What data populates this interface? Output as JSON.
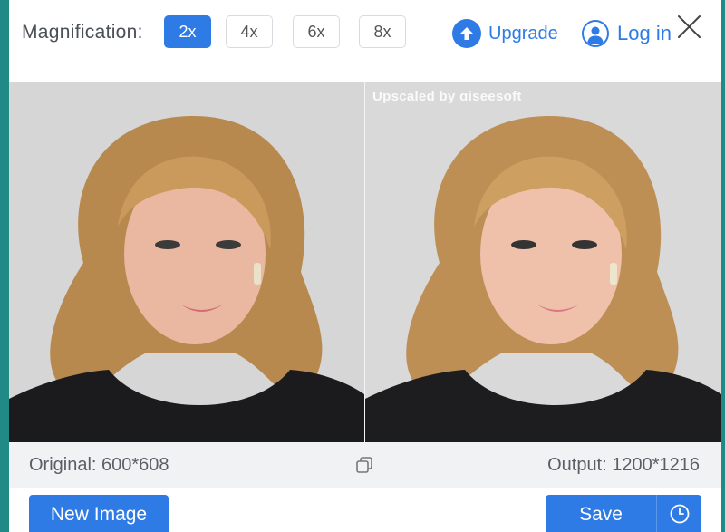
{
  "topbar": {
    "magnification_label": "Magnification:",
    "options": [
      "2x",
      "4x",
      "6x",
      "8x"
    ],
    "selected": "2x",
    "upgrade_label": "Upgrade",
    "login_label": "Log in"
  },
  "preview": {
    "watermark": "Upscaled by ɑiseesoft"
  },
  "info": {
    "original": "Original: 600*608",
    "output": "Output: 1200*1216"
  },
  "actions": {
    "new_image": "New Image",
    "save": "Save"
  },
  "icons": [
    "upload-arrow-icon",
    "user-icon",
    "close-icon",
    "copy-icon",
    "clock-icon"
  ],
  "colors": {
    "accent": "#2f7be6",
    "background": "#1f8a86",
    "infobar": "#f1f2f4"
  }
}
